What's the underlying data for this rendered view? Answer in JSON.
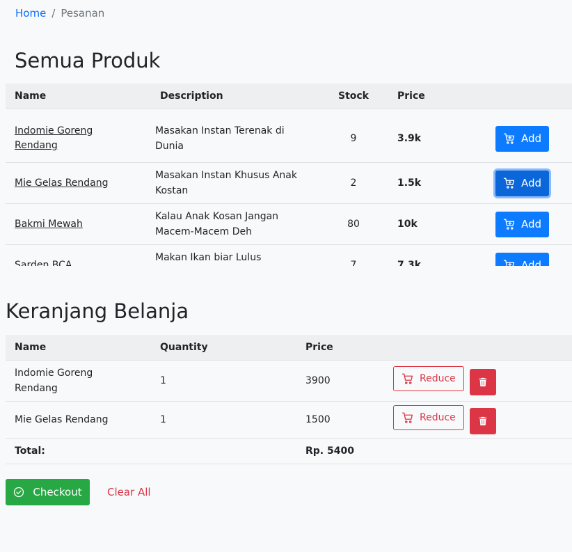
{
  "breadcrumb": {
    "home": "Home",
    "separator": "/",
    "current": "Pesanan"
  },
  "products": {
    "title": "Semua Produk",
    "columns": [
      "Name",
      "Description",
      "Stock",
      "Price",
      ""
    ],
    "add_label": "Add",
    "rows": [
      {
        "name": "Indomie Goreng Rendang",
        "description": "Masakan Instan Terenak di Dunia",
        "stock": "9",
        "price": "3.9k"
      },
      {
        "name": "Mie Gelas Rendang",
        "description": "Masakan Instan Khusus Anak Kostan",
        "stock": "2",
        "price": "1.5k"
      },
      {
        "name": "Bakmi Mewah",
        "description": "Kalau Anak Kosan Jangan Macem-Macem Deh",
        "stock": "80",
        "price": "10k"
      },
      {
        "name": "Sarden BCA",
        "description": "Makan Ikan biar Lulus Bootcamp Inosoft",
        "stock": "7",
        "price": "7.3k"
      }
    ]
  },
  "cart": {
    "title": "Keranjang Belanja",
    "columns": [
      "Name",
      "Quantity",
      "Price",
      ""
    ],
    "reduce_label": "Reduce",
    "rows": [
      {
        "name": "Indomie Goreng Rendang",
        "quantity": "1",
        "price": "3900"
      },
      {
        "name": "Mie Gelas Rendang",
        "quantity": "1",
        "price": "1500"
      }
    ],
    "total_label": "Total:",
    "total_value": "Rp. 5400"
  },
  "actions": {
    "checkout": "Checkout",
    "clear_all": "Clear All"
  },
  "colors": {
    "primary": "#0d7bff",
    "danger": "#dc3545",
    "success": "#28a745"
  }
}
